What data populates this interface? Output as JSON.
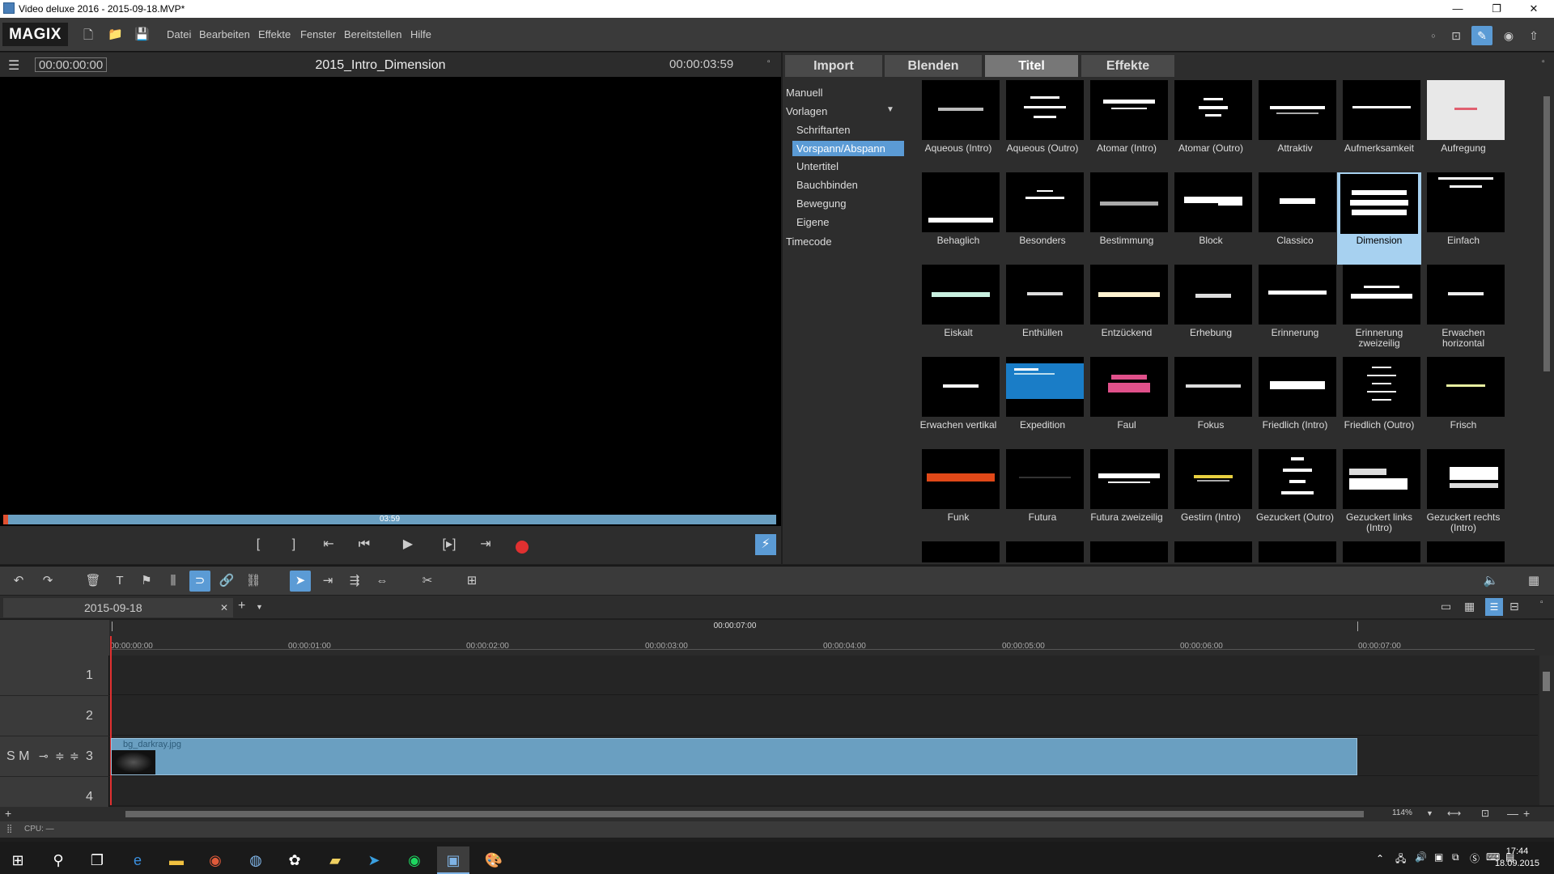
{
  "window": {
    "title": "Video deluxe 2016 - 2015-09-18.MVP*",
    "minimize": "—",
    "restore": "❐",
    "close": "✕"
  },
  "menubar": {
    "logo": "MAGIX",
    "items": [
      "Datei",
      "Bearbeiten",
      "Effekte",
      "Fenster",
      "Bereitstellen",
      "Hilfe"
    ]
  },
  "preview": {
    "timecode_start": "00:00:00:00",
    "project_name": "2015_Intro_Dimension",
    "timecode_end": "00:00:03:59",
    "scrub_label": "03:59"
  },
  "panel": {
    "tabs": [
      "Import",
      "Blenden",
      "Titel",
      "Effekte"
    ],
    "active_tab": "Titel",
    "categories": [
      {
        "label": "Manuell",
        "level": 0
      },
      {
        "label": "Vorlagen",
        "level": 0
      },
      {
        "label": "Schriftarten",
        "level": 1
      },
      {
        "label": "Vorspann/Abspann",
        "level": 1,
        "selected": true
      },
      {
        "label": "Untertitel",
        "level": 1
      },
      {
        "label": "Bauchbinden",
        "level": 1
      },
      {
        "label": "Bewegung",
        "level": 1
      },
      {
        "label": "Eigene",
        "level": 1
      },
      {
        "label": "Timecode",
        "level": 0
      }
    ],
    "templates": [
      "Aqueous (Intro)",
      "Aqueous (Outro)",
      "Atomar (Intro)",
      "Atomar (Outro)",
      "Attraktiv",
      "Aufmerksamkeit",
      "Aufregung",
      "Behaglich",
      "Besonders",
      "Bestimmung",
      "Block",
      "Classico",
      "Dimension",
      "Einfach",
      "Eiskalt",
      "Enthüllen",
      "Entzückend",
      "Erhebung",
      "Erinnerung",
      "Erinnerung zweizeilig",
      "Erwachen horizontal",
      "Erwachen vertikal",
      "Expedition",
      "Faul",
      "Fokus",
      "Friedlich (Intro)",
      "Friedlich (Outro)",
      "Frisch",
      "Funk",
      "Futura",
      "Futura zweizeilig",
      "Gestirn (Intro)",
      "Gezuckert (Outro)",
      "Gezuckert links (Intro)",
      "Gezuckert rechts (Intro)"
    ],
    "selected_template": "Dimension"
  },
  "timeline": {
    "project_tab": "2015-09-18",
    "ruler_top": "00:00:07:00",
    "ruler_marks": [
      "00:00:00:00",
      "00:00:01:00",
      "00:00:02:00",
      "00:00:03:00",
      "00:00:04:00",
      "00:00:05:00",
      "00:00:06:00",
      "00:00:07:00"
    ],
    "tracks": [
      "1",
      "2",
      "3",
      "4"
    ],
    "track3_controls": "S M",
    "clip_name": "bg_darkray.jpg",
    "zoom": "114%"
  },
  "status": {
    "cpu": "CPU: —"
  },
  "taskbar": {
    "time": "17:44",
    "date": "18.09.2015"
  }
}
